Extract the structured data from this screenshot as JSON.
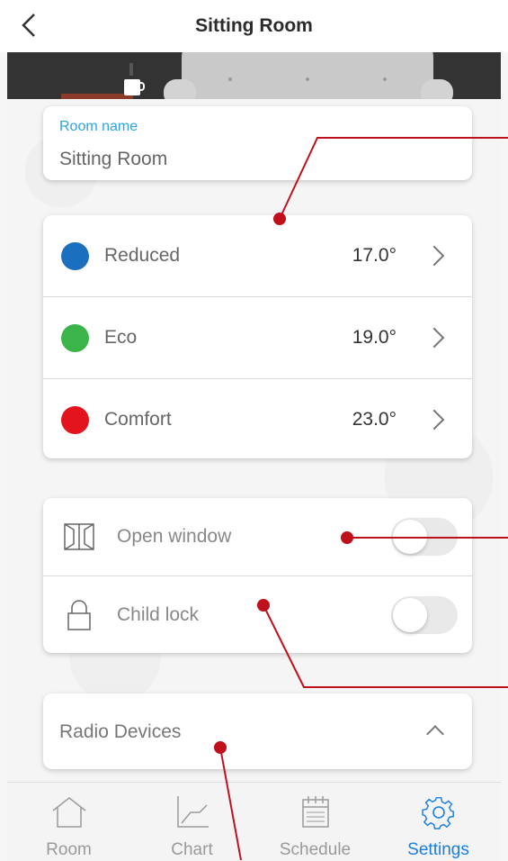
{
  "header": {
    "title": "Sitting Room"
  },
  "room": {
    "label": "Room name",
    "value": "Sitting Room"
  },
  "temperatures": [
    {
      "label": "Reduced",
      "value": "17.0°",
      "color": "#1a6fbf"
    },
    {
      "label": "Eco",
      "value": "19.0°",
      "color": "#3bb54a"
    },
    {
      "label": "Comfort",
      "value": "23.0°",
      "color": "#e3141e"
    }
  ],
  "toggles": [
    {
      "label": "Open window",
      "icon": "window-icon",
      "on": false
    },
    {
      "label": "Child lock",
      "icon": "lock-icon",
      "on": false
    }
  ],
  "radio": {
    "label": "Radio Devices"
  },
  "tabs": [
    {
      "label": "Room",
      "icon": "home-icon"
    },
    {
      "label": "Chart",
      "icon": "chart-icon"
    },
    {
      "label": "Schedule",
      "icon": "calendar-icon"
    },
    {
      "label": "Settings",
      "icon": "gear-icon",
      "active": true
    }
  ],
  "colors": {
    "accent": "#1a7de3",
    "room_label": "#2aa4e2",
    "annotation": "#c0101c"
  }
}
